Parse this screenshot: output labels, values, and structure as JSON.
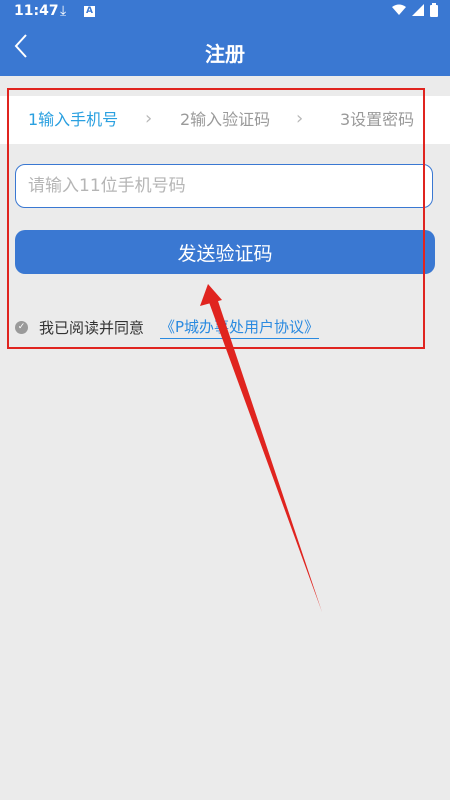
{
  "status_bar": {
    "time": "11:47",
    "icons": [
      "download-icon",
      "a-icon",
      "wifi-icon",
      "signal-icon",
      "battery-icon"
    ]
  },
  "header": {
    "title": "注册",
    "back_icon": "back-chevron-icon"
  },
  "steps": [
    {
      "label": "1输入手机号",
      "active": true
    },
    {
      "label": "2输入验证码",
      "active": false
    },
    {
      "label": "3设置密码",
      "active": false
    }
  ],
  "phone": {
    "placeholder": "请输入11位手机号码",
    "value": ""
  },
  "send_button": {
    "label": "发送验证码"
  },
  "agreement": {
    "text": "我已阅读并同意",
    "link": "《P城办事处用户协议》"
  },
  "colors": {
    "primary": "#3a78d2",
    "active_step": "#2aa0e0",
    "link": "#2a8ae0",
    "annotation": "#e0241f",
    "background": "#ebebeb"
  }
}
